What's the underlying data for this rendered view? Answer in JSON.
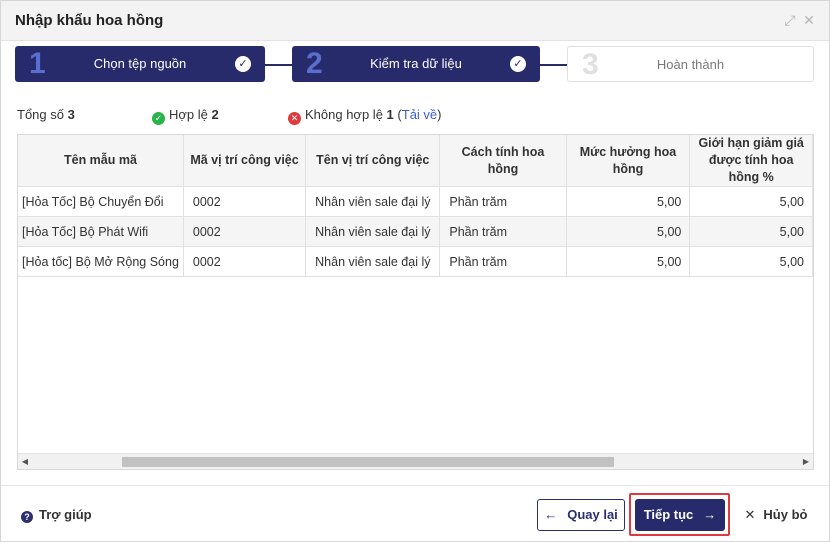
{
  "header": {
    "title": "Nhập khẩu hoa hồng",
    "expand_glyph": "⤢",
    "close_glyph": "✕"
  },
  "steps": [
    {
      "number": "1",
      "label": "Chọn tệp nguồn",
      "state": "done",
      "check": "✓"
    },
    {
      "number": "2",
      "label": "Kiểm tra dữ liệu",
      "state": "done",
      "check": "✓"
    },
    {
      "number": "3",
      "label": "Hoàn thành",
      "state": "todo"
    }
  ],
  "summary": {
    "total_label": "Tổng số",
    "total_value": "3",
    "valid_label": "Hợp lệ",
    "valid_value": "2",
    "invalid_label": "Không hợp lệ",
    "invalid_value": "1",
    "download_link": "Tải về",
    "open_paren": "(",
    "close_paren": ")",
    "valid_glyph": "✓",
    "invalid_glyph": "✕"
  },
  "table": {
    "columns": [
      "Tên mẫu mã",
      "Mã vị trí công việc",
      "Tên vị trí công việc",
      "Cách tính hoa hồng",
      "Mức hưởng hoa hồng",
      "Giới hạn giảm giá được tính hoa hồng %"
    ],
    "rows": [
      [
        "[Hỏa Tốc] Bộ Chuyển Đổi",
        "0002",
        "Nhân viên sale đại lý",
        "Phần trăm",
        "5,00",
        "5,00"
      ],
      [
        "[Hỏa Tốc] Bộ Phát Wifi",
        "0002",
        "Nhân viên sale đại lý",
        "Phần trăm",
        "5,00",
        "5,00"
      ],
      [
        "[Hỏa tốc] Bộ Mở Rộng Sóng",
        "0002",
        "Nhân viên sale đại lý",
        "Phần trăm",
        "5,00",
        "5,00"
      ]
    ]
  },
  "scrollbar": {
    "left_glyph": "◀",
    "right_glyph": "▶"
  },
  "footer": {
    "help_label": "Trợ giúp",
    "help_glyph": "?",
    "back_label": "Quay lại",
    "back_glyph": "←",
    "next_label": "Tiếp tục",
    "next_glyph": "→",
    "cancel_label": "Hủy bỏ",
    "cancel_glyph": "✕"
  },
  "colors": {
    "primary": "#272b6b",
    "step_number": "#5a6ed0",
    "highlight": "#e0393e",
    "ok": "#2ab34a",
    "link": "#3b5bd6"
  }
}
